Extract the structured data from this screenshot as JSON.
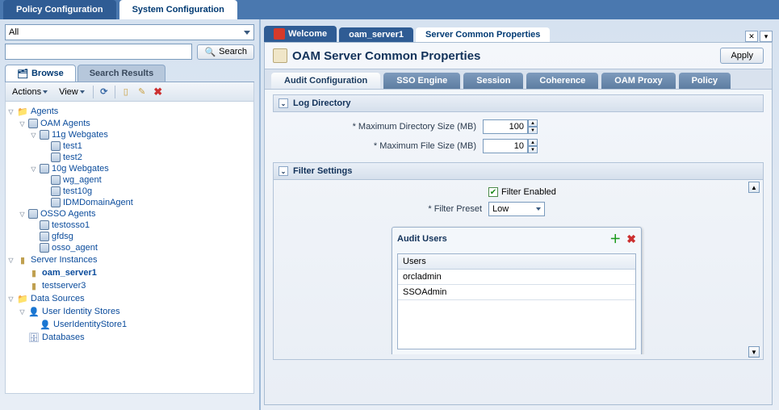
{
  "topTabs": {
    "policy": "Policy Configuration",
    "system": "System Configuration"
  },
  "search": {
    "dropdown": "All",
    "button": "Search"
  },
  "navTabs": {
    "browse": "Browse",
    "results": "Search Results"
  },
  "toolbar": {
    "actions": "Actions",
    "view": "View"
  },
  "tree": {
    "agents": "Agents",
    "oamAgents": "OAM Agents",
    "wg11": "11g Webgates",
    "test1": "test1",
    "test2": "test2",
    "wg10": "10g Webgates",
    "wg_agent": "wg_agent",
    "test10g": "test10g",
    "idm": "IDMDomainAgent",
    "osso": "OSSO Agents",
    "testosso1": "testosso1",
    "gfdsg": "gfdsg",
    "osso_agent": "osso_agent",
    "serverInst": "Server Instances",
    "oam_server1": "oam_server1",
    "testserver3": "testserver3",
    "dataSources": "Data Sources",
    "userIdentity": "User Identity Stores",
    "userStore1": "UserIdentityStore1",
    "databases": "Databases"
  },
  "contentTabs": {
    "welcome": "Welcome",
    "server": "oam_server1",
    "props": "Server Common Properties"
  },
  "page": {
    "title": "OAM Server Common Properties",
    "apply": "Apply"
  },
  "subTabs": {
    "audit": "Audit Configuration",
    "sso": "SSO Engine",
    "session": "Session",
    "coherence": "Coherence",
    "oamProxy": "OAM Proxy",
    "policy": "Policy"
  },
  "logDir": {
    "heading": "Log Directory",
    "maxDirSize": "Maximum Directory Size (MB)",
    "maxDirSizeVal": "100",
    "maxFileSize": "Maximum File Size (MB)",
    "maxFileSizeVal": "10"
  },
  "filter": {
    "heading": "Filter Settings",
    "enabled": "Filter Enabled",
    "preset": "Filter Preset",
    "presetVal": "Low"
  },
  "audit": {
    "heading": "Audit Users",
    "col": "Users",
    "rows": [
      "orcladmin",
      "SSOAdmin"
    ]
  }
}
